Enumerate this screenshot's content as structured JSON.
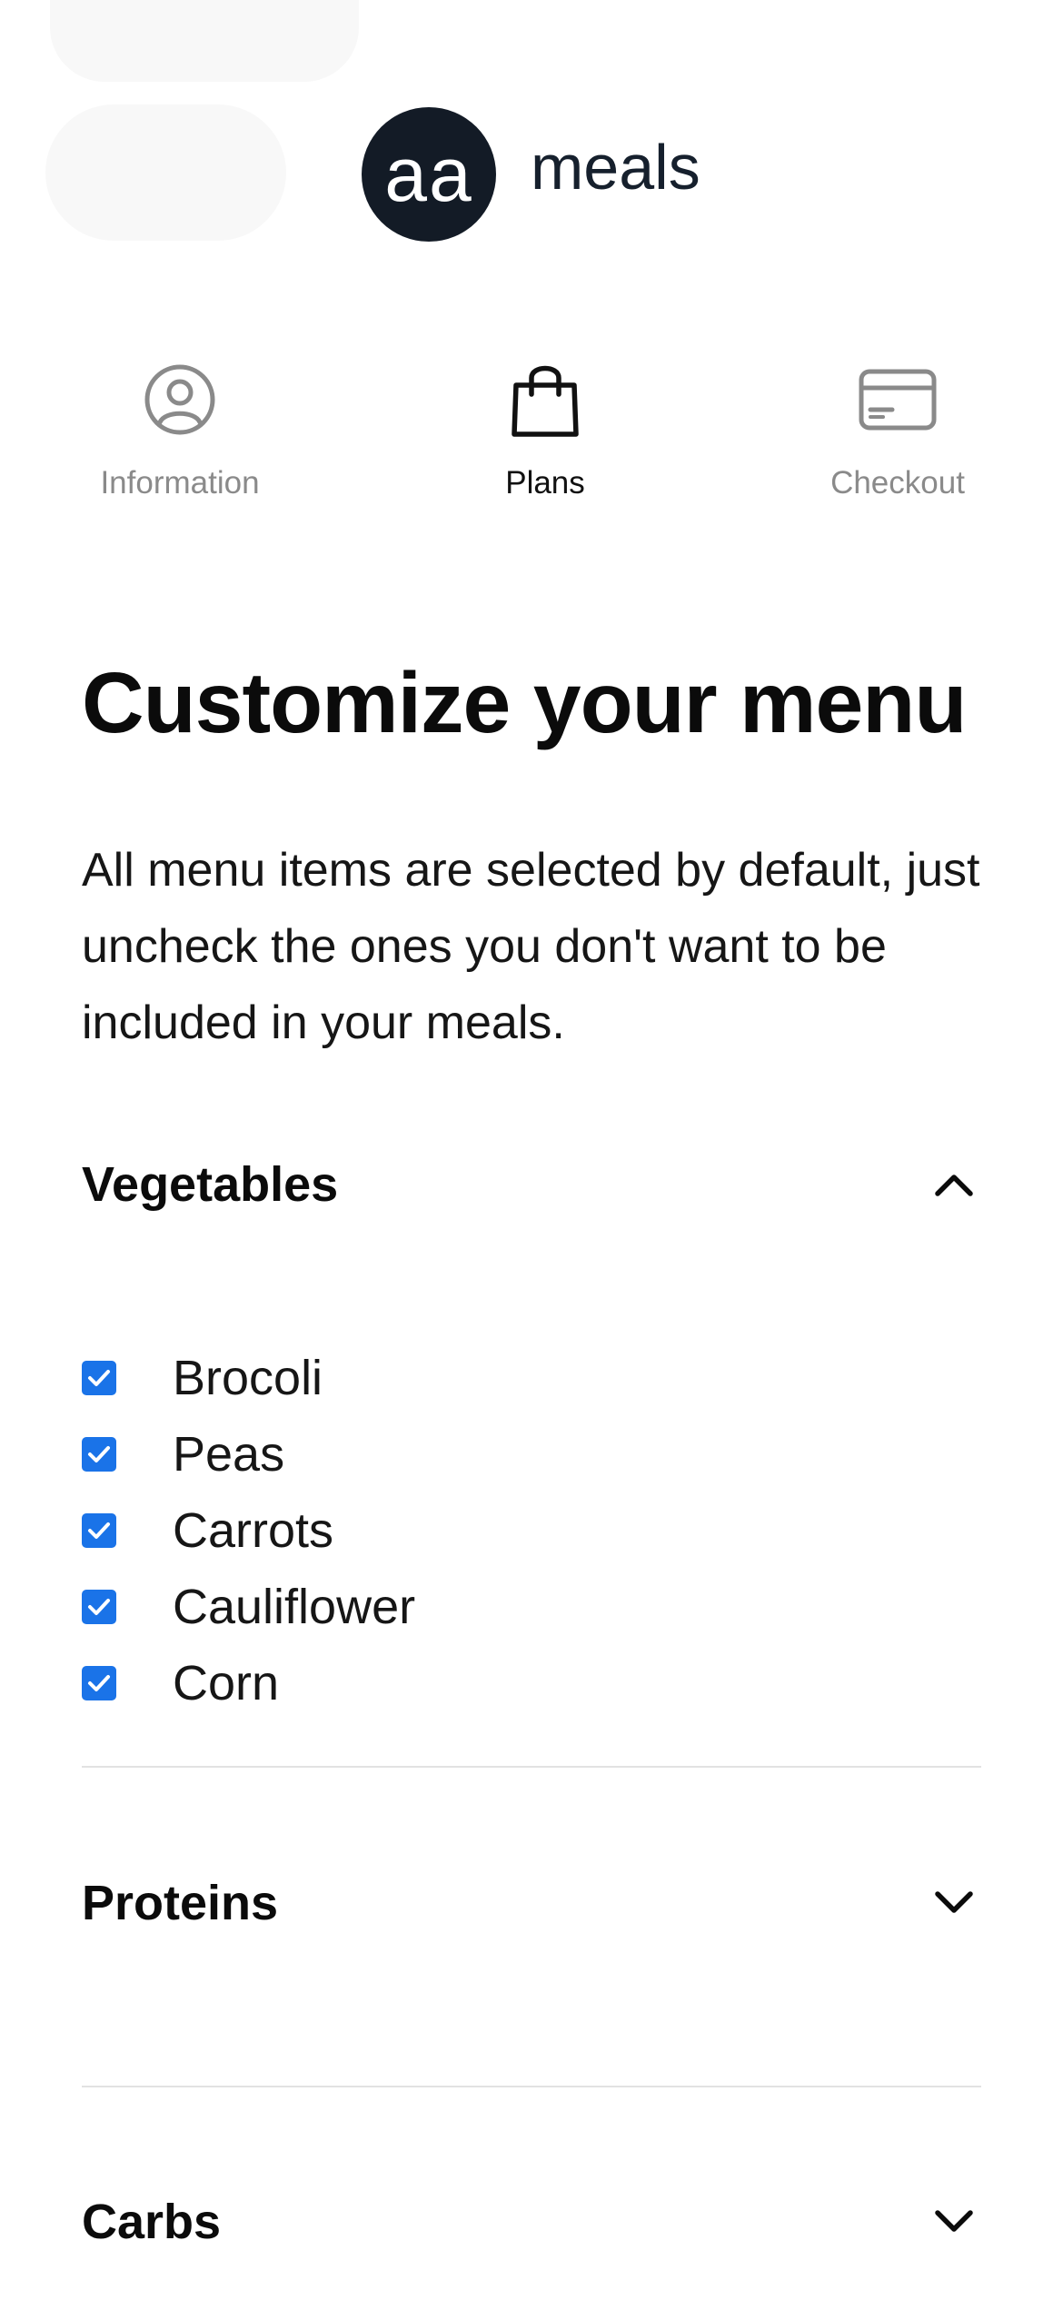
{
  "brand": {
    "logo_text": "aa",
    "name": "meals"
  },
  "steps": [
    {
      "label": "Information",
      "icon": "user-circle-icon",
      "active": false
    },
    {
      "label": "Plans",
      "icon": "shopping-bag-icon",
      "active": true
    },
    {
      "label": "Checkout",
      "icon": "credit-card-icon",
      "active": false
    }
  ],
  "page": {
    "title": "Customize your menu",
    "intro": "All menu items are selected by default, just uncheck the ones you don't want to be included in your meals."
  },
  "sections": [
    {
      "title": "Vegetables",
      "expanded": true,
      "items": [
        {
          "label": "Brocoli",
          "checked": true
        },
        {
          "label": "Peas",
          "checked": true
        },
        {
          "label": "Carrots",
          "checked": true
        },
        {
          "label": "Cauliflower",
          "checked": true
        },
        {
          "label": "Corn",
          "checked": true
        }
      ]
    },
    {
      "title": "Proteins",
      "expanded": false
    },
    {
      "title": "Carbs",
      "expanded": false
    }
  ],
  "colors": {
    "checkbox": "#1a73e8",
    "logo_bg": "#131b26",
    "inactive_step": "#8a8a8a",
    "divider": "#e2e2e2"
  }
}
